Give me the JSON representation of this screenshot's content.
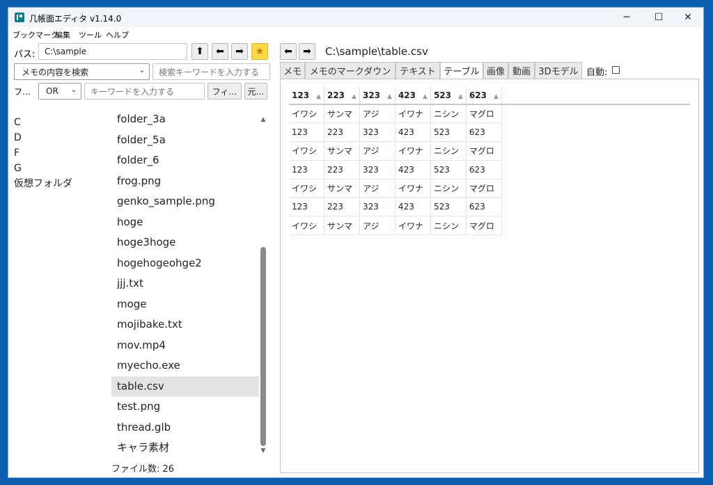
{
  "window": {
    "title": "几帳面エディタ v1.14.0"
  },
  "titlebar": {
    "minimize": "─",
    "maximize": "☐",
    "close": "✕"
  },
  "menu": [
    "ブックマーク",
    "編集",
    "ツール",
    "ヘルプ"
  ],
  "path_bar": {
    "label": "パス:",
    "value": "C:\\sample"
  },
  "search": {
    "mode": "メモの内容を検索",
    "placeholder": "検索キーワードを入力する"
  },
  "filter": {
    "label": "フ…",
    "op": "OR",
    "placeholder": "キーワードを入力する",
    "filter_button": "フィ…",
    "restore_button": "元…"
  },
  "drives": [
    "C",
    "D",
    "F",
    "G",
    "仮想フォルダ"
  ],
  "files": [
    "folder_3a",
    "folder_5a",
    "folder_6",
    "frog.png",
    "genko_sample.png",
    "hoge",
    "hoge3hoge",
    "hogehogeohge2",
    "jjj.txt",
    "moge",
    "mojibake.txt",
    "mov.mp4",
    "myecho.exe",
    "table.csv",
    "test.png",
    "thread.glb",
    "キャラ素材"
  ],
  "selected_file": "table.csv",
  "file_count": "ファイル数: 26",
  "viewer": {
    "path": "C:\\sample\\table.csv",
    "tabs": [
      "メモ",
      "メモのマークダウン",
      "テキスト",
      "テーブル",
      "画像",
      "動画",
      "3Dモデル"
    ],
    "active_tab": "テーブル",
    "auto_label": "自動:"
  },
  "table": {
    "headers": [
      "123",
      "223",
      "323",
      "423",
      "523",
      "623"
    ],
    "rows": [
      [
        "イワシ",
        "サンマ",
        "アジ",
        "イワナ",
        "ニシン",
        "マグロ"
      ],
      [
        "123",
        "223",
        "323",
        "423",
        "523",
        "623"
      ],
      [
        "イワシ",
        "サンマ",
        "アジ",
        "イワナ",
        "ニシン",
        "マグロ"
      ],
      [
        "123",
        "223",
        "323",
        "423",
        "523",
        "623"
      ],
      [
        "イワシ",
        "サンマ",
        "アジ",
        "イワナ",
        "ニシン",
        "マグロ"
      ],
      [
        "123",
        "223",
        "323",
        "423",
        "523",
        "623"
      ],
      [
        "イワシ",
        "サンマ",
        "アジ",
        "イワナ",
        "ニシン",
        "マグロ"
      ]
    ]
  }
}
